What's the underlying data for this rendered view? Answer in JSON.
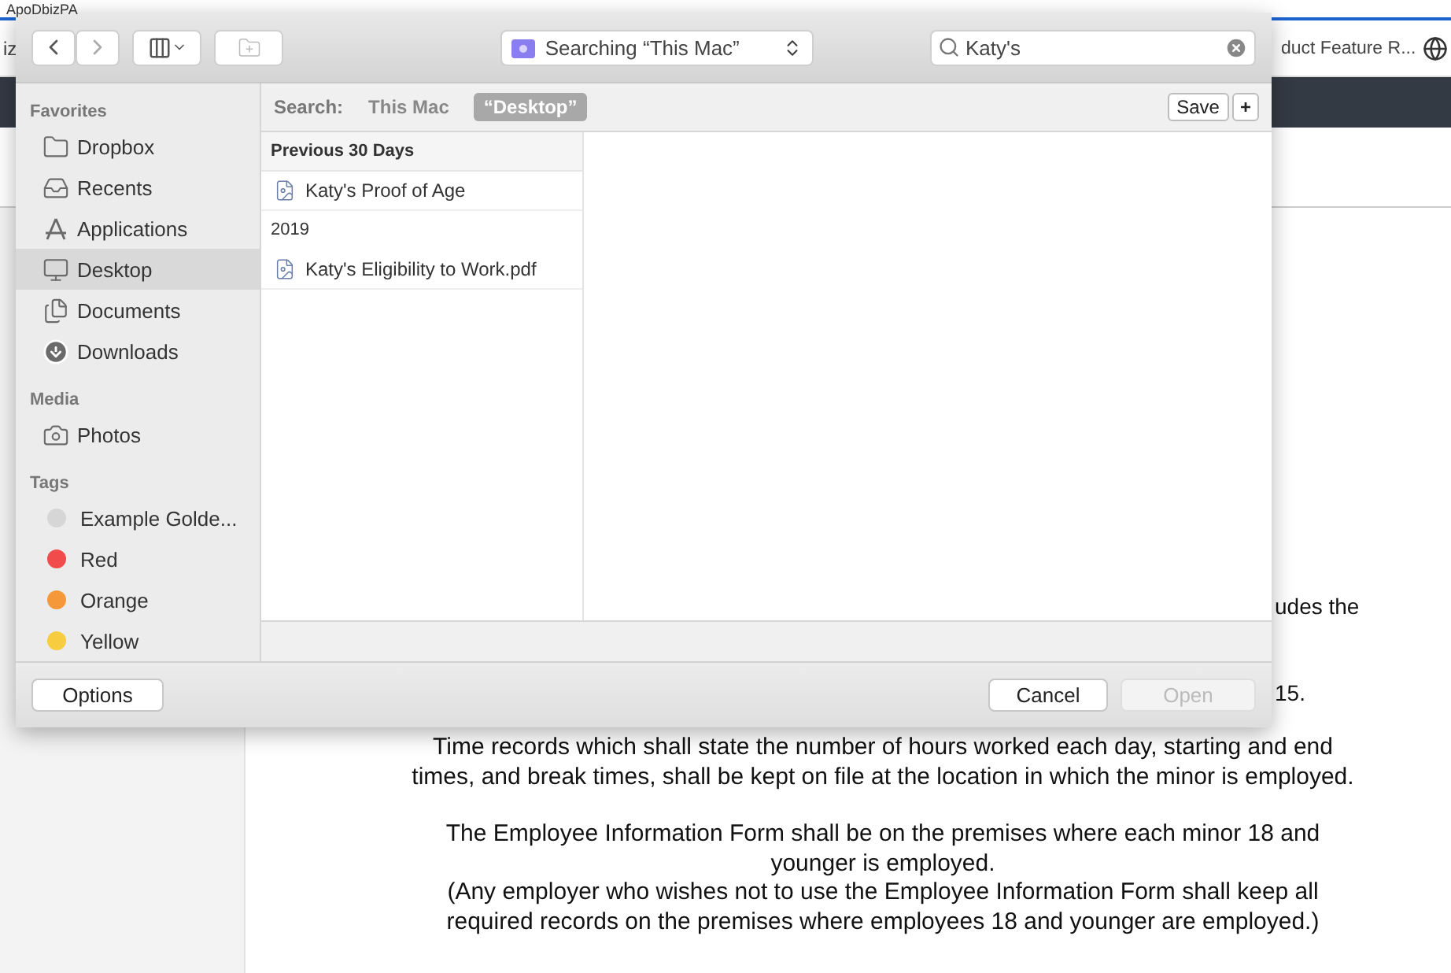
{
  "browser": {
    "title_fragment": "ApoDbizPA",
    "tab_left": "iz",
    "tab_right": "duct Feature R..."
  },
  "document": {
    "fragments": [
      "udes the",
      "15."
    ],
    "paragraphs": [
      "Time records which shall state the number of hours worked each day, starting and end times, and break times, shall be kept on file at the location in which the minor is employed.",
      "The Employee Information Form shall be on the premises where each minor 18 and younger is employed.",
      "(Any employer who wishes not to use the Employee Information Form shall keep all required records on the premises where employees 18 and younger are employed.)"
    ]
  },
  "dialog": {
    "location": "Searching “This Mac”",
    "search": "Katy's",
    "scope": {
      "label": "Search:",
      "options": [
        {
          "label": "This Mac",
          "selected": false
        },
        {
          "label": "“Desktop”",
          "selected": true
        }
      ],
      "save": "Save",
      "add": "+"
    },
    "sidebar": [
      {
        "heading": "Favorites",
        "items": [
          {
            "label": "Dropbox",
            "kind": "folder",
            "selected": false
          },
          {
            "label": "Recents",
            "kind": "recents",
            "selected": false
          },
          {
            "label": "Applications",
            "kind": "apps",
            "selected": false
          },
          {
            "label": "Desktop",
            "kind": "desktop",
            "selected": true
          },
          {
            "label": "Documents",
            "kind": "documents",
            "selected": false
          },
          {
            "label": "Downloads",
            "kind": "downloads",
            "selected": false
          }
        ]
      },
      {
        "heading": "Media",
        "items": [
          {
            "label": "Photos",
            "kind": "photos",
            "selected": false
          }
        ]
      },
      {
        "heading": "Tags",
        "items": [
          {
            "label": "Example Golde...",
            "kind": "tag",
            "color": "#d6d6d6",
            "selected": false
          },
          {
            "label": "Red",
            "kind": "tag",
            "color": "#f24b4b",
            "selected": false
          },
          {
            "label": "Orange",
            "kind": "tag",
            "color": "#f5983a",
            "selected": false
          },
          {
            "label": "Yellow",
            "kind": "tag",
            "color": "#f7cc3f",
            "selected": false
          }
        ]
      }
    ],
    "results": [
      {
        "heading": "Previous 30 Days",
        "files": [
          "Katy's Proof of Age"
        ]
      },
      {
        "heading": "2019",
        "files": [
          "Katy's Eligibility to Work.pdf"
        ]
      }
    ],
    "buttons": {
      "options": "Options",
      "cancel": "Cancel",
      "open": "Open",
      "open_disabled": true
    }
  }
}
